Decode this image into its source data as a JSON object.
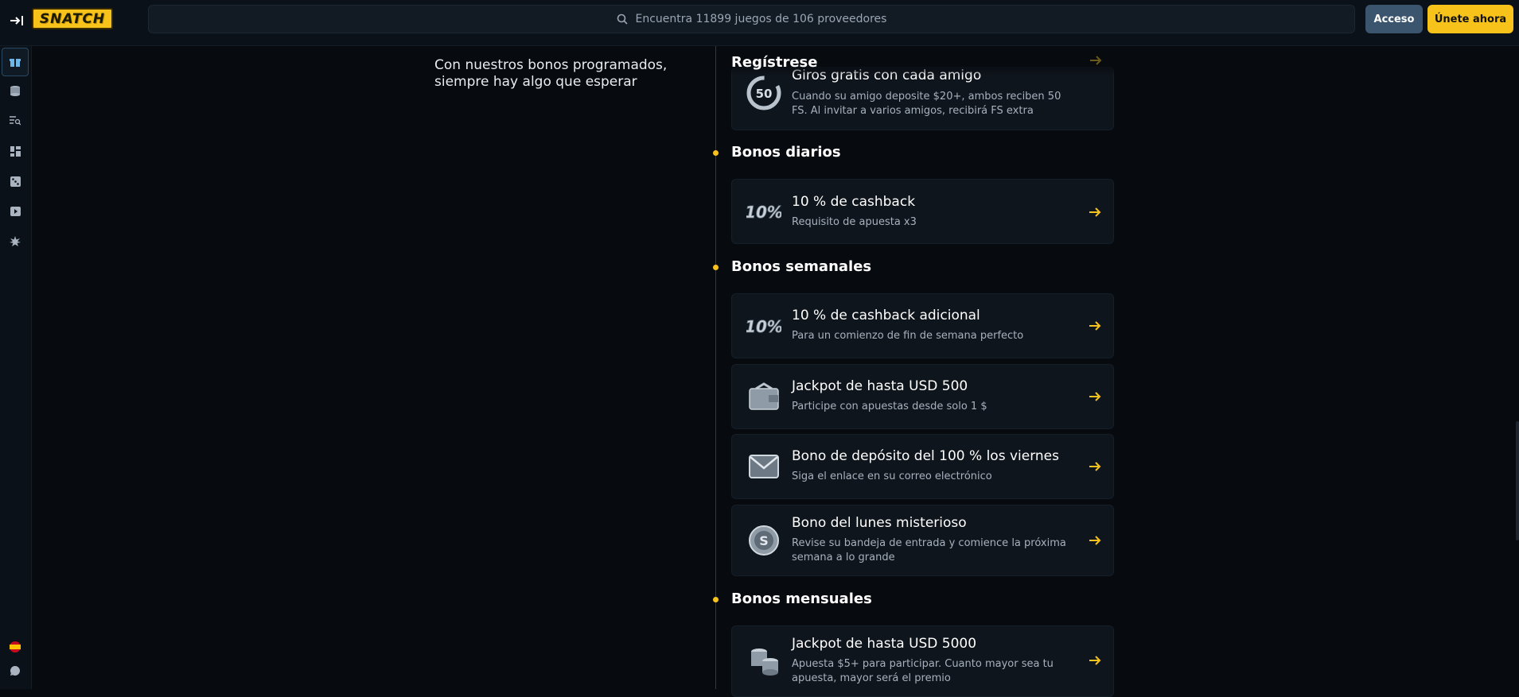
{
  "header": {
    "logo_text": "SNATCH",
    "search_placeholder": "Encuentra 11899 juegos de 106 proveedores",
    "login_label": "Acceso",
    "join_label": "Únete ahora"
  },
  "colors": {
    "accent": "#f7c31a",
    "login_bg": "#3b556f",
    "background": "#070b10"
  },
  "sidebar": {
    "items": [
      {
        "icon": "gift-icon",
        "active": true
      },
      {
        "icon": "coins-icon",
        "active": false
      },
      {
        "icon": "list-search-icon",
        "active": false
      },
      {
        "icon": "dashboard-icon",
        "active": false
      },
      {
        "icon": "dice-icon",
        "active": false
      },
      {
        "icon": "live-video-icon",
        "active": false
      },
      {
        "icon": "burst-icon",
        "active": false
      }
    ],
    "bottom": [
      {
        "icon": "spain-flag-icon"
      },
      {
        "icon": "chat-icon"
      }
    ]
  },
  "intro": {
    "text": "Con nuestros bonos programados, siempre hay algo que esperar"
  },
  "sections": {
    "register": {
      "title": "Regístrese",
      "cards": [
        {
          "title": "Giros gratis con cada amigo",
          "desc": "Cuando su amigo deposite $20+, ambos reciben 50 FS. Al invitar a varios amigos, recibirá FS extra",
          "icon": "fifty-spins-icon"
        }
      ]
    },
    "daily": {
      "title": "Bonos diarios",
      "cards": [
        {
          "title": "10 % de cashback",
          "desc": "Requisito de apuesta x3",
          "icon": "ten-percent-icon"
        }
      ]
    },
    "weekly": {
      "title": "Bonos semanales",
      "cards": [
        {
          "title": "10 % de cashback adicional",
          "desc": "Para un comienzo de fin de semana perfecto",
          "icon": "ten-percent-icon"
        },
        {
          "title": "Jackpot de hasta USD 500",
          "desc": "Participe con apuestas desde solo 1 $",
          "icon": "wallet-icon"
        },
        {
          "title": "Bono de depósito del 100 % los viernes",
          "desc": "Siga el enlace en su correo electrónico",
          "icon": "envelope-icon"
        },
        {
          "title": "Bono del lunes misterioso",
          "desc": "Revise su bandeja de entrada y comience la próxima semana a lo grande",
          "icon": "coin-s-icon"
        }
      ]
    },
    "monthly": {
      "title": "Bonos mensuales",
      "cards": [
        {
          "title": "Jackpot de hasta USD 5000",
          "desc": "Apuesta $5+ para participar. Cuanto mayor sea tu apuesta, mayor será el premio",
          "icon": "coin-stack-icon"
        }
      ]
    }
  }
}
